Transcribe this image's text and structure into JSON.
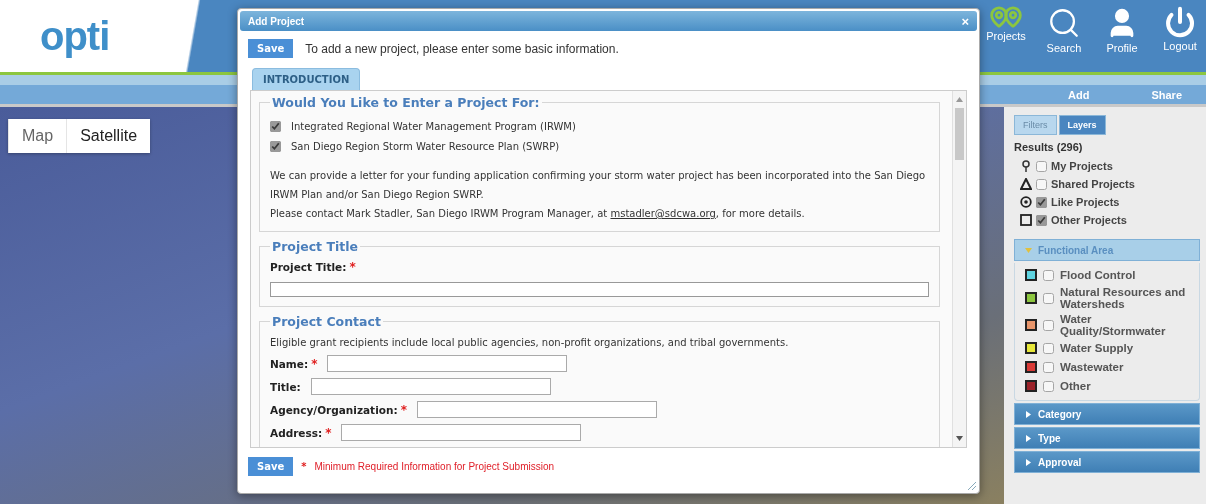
{
  "header": {
    "logo": "opti",
    "nav": [
      {
        "label": "Projects",
        "kind": "pins"
      },
      {
        "label": "Search",
        "kind": "search"
      },
      {
        "label": "Profile",
        "kind": "person"
      },
      {
        "label": "Logout",
        "kind": "power"
      }
    ]
  },
  "subnav": {
    "items": [
      "Add",
      "Share"
    ]
  },
  "map": {
    "buttons": [
      {
        "label": "Map",
        "selected": false
      },
      {
        "label": "Satellite",
        "selected": true
      }
    ]
  },
  "sidebar": {
    "tabs": [
      {
        "label": "Filters",
        "selected": false
      },
      {
        "label": "Layers",
        "selected": true
      }
    ],
    "results": "Results (296)",
    "layers": [
      {
        "label": "My Projects",
        "kind": "pin",
        "checked": false
      },
      {
        "label": "Shared Projects",
        "kind": "triangle",
        "checked": false
      },
      {
        "label": "Like Projects",
        "kind": "target",
        "checked": true
      },
      {
        "label": "Other Projects",
        "kind": "square",
        "checked": true
      }
    ],
    "groups": [
      {
        "title": "Functional Area",
        "expanded": true,
        "items": [
          {
            "label": "Flood Control",
            "color": "#5fd3e0",
            "checked": false
          },
          {
            "label": "Natural Resources and Watersheds",
            "color": "#8cc63f",
            "checked": false
          },
          {
            "label": "Water Quality/Stormwater",
            "color": "#e8956b",
            "checked": false
          },
          {
            "label": "Water Supply",
            "color": "#e8e83a",
            "checked": false
          },
          {
            "label": "Wastewater",
            "color": "#d93a36",
            "checked": false
          },
          {
            "label": "Other",
            "color": "#9b2229",
            "checked": false
          }
        ]
      },
      {
        "title": "Category",
        "expanded": false
      },
      {
        "title": "Type",
        "expanded": false
      },
      {
        "title": "Approval",
        "expanded": false
      }
    ]
  },
  "dialog": {
    "title": "Add Project",
    "close": "×",
    "save": "Save",
    "intro": "To add a new project, please enter some basic information.",
    "tabs": [
      {
        "label": "INTRODUCTION",
        "selected": true
      }
    ],
    "required_mark": "*",
    "sections": [
      {
        "legend": "Would You Like to Enter a Project For:",
        "options": [
          {
            "label": "Integrated Regional Water Management Program (IRWM)",
            "checked": true
          },
          {
            "label": "San Diego Region Storm Water Resource Plan (SWRP)",
            "checked": true
          }
        ],
        "paragraphs": [
          {
            "text": "We can provide a letter for your funding application confirming your storm water project has been incorporated into the San Diego IRWM Plan and/or San Diego Region SWRP."
          },
          {
            "text": "Please contact Mark Stadler, San Diego IRWM Program Manager, at ",
            "link": "mstadler@sdcwa.org",
            "after": ", for more details."
          }
        ]
      },
      {
        "legend": "Project Title",
        "fields": [
          {
            "label": "Project Title:",
            "required": true,
            "kind": "wide"
          }
        ]
      },
      {
        "legend": "Project Contact",
        "note": "Eligible grant recipients include local public agencies, non-profit organizations, and tribal governments.",
        "fields": [
          {
            "label": "Name:",
            "required": true,
            "kind": "inline"
          },
          {
            "label": "Title:",
            "required": false,
            "kind": "inline"
          },
          {
            "label": "Agency/Organization:",
            "required": true,
            "kind": "inline"
          },
          {
            "label": "Address:",
            "required": true,
            "kind": "inline"
          }
        ]
      }
    ],
    "footer": {
      "save": "Save",
      "mark": "*",
      "note": "Minimum Required Information for Project Submission"
    }
  }
}
